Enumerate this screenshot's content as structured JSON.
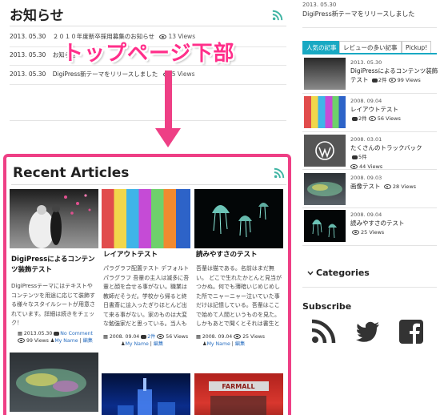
{
  "news": {
    "title": "お知らせ",
    "items": [
      {
        "date": "2013. 05.30",
        "text": "２０１０年度新卒採用募集のお知らせ",
        "views": "13 Views"
      },
      {
        "date": "2013. 05.30",
        "text": "お知らせ",
        "views": ""
      },
      {
        "date": "2013. 05.30",
        "text": "DigiPress新テーマをリリースしました",
        "views": "5 Views"
      }
    ]
  },
  "annotation": {
    "callout": "トップページ下部",
    "arrow_color": "#ee3f85",
    "frame_color": "#ee3f85"
  },
  "recent": {
    "title": "Recent Articles",
    "cards": [
      {
        "title": "DigiPressによるコンテンツ装飾テスト",
        "excerpt": "DigiPressテーマにはテキストやコンテンツを用途に応じて装飾する様々なスタイルシートが用意されています。詳細は続きをチェック！",
        "date": "2013.05.30",
        "comments": "No Comment",
        "views": "99 Views",
        "author": "My Name",
        "edit": "編集"
      },
      {
        "title": "レイアウトテスト",
        "excerpt": "パラグラフ配置テスト デフォルトパラグラフ 吾輩の主人は滅多に吾輩と顔を合せる事がない。職業は教師だそうだ。学校から帰ると終日書斎に這入ったぎりほとんど出て来る事がない。家のものは大変な勉強家だと思っている。当人も勉強家であるかのごとく見せ…",
        "date": "2008. 09.04",
        "comments": "2件",
        "views": "56 Views",
        "author": "My Name",
        "edit": "編集"
      },
      {
        "title": "読みやすさのテスト",
        "excerpt": "吾輩は猫である。名前はまだ無い。 どこで生れたかとんと見当がつかぬ。何でも薄暗いじめじめした所でニャーニャー泣いていた事だけは記憶している。吾輩はここで始めて人間というものを見た。しかもあとで聞くとそれは書生という人間中で一番獰悪な種族であった…",
        "date": "2008. 09.04",
        "comments": "",
        "views": "25 Views",
        "author": "My Name",
        "edit": "編集"
      },
      {
        "title": "",
        "excerpt": ""
      },
      {
        "title": "",
        "excerpt": ""
      },
      {
        "title": "",
        "excerpt": "",
        "thumb_text": "FARMALL"
      }
    ]
  },
  "sidebar": {
    "top_item": {
      "date": "2013. 05.30",
      "text": "DigiPress新テーマをリリースしました"
    },
    "tabs": [
      "人気の記事",
      "レビューの多い記事",
      "Pickup!"
    ],
    "popular": [
      {
        "date": "2013. 05.30",
        "title": "DigiPressによるコンテンツ装飾テスト",
        "comments": "2件",
        "views": "99 Views"
      },
      {
        "date": "2008. 09.04",
        "title": "レイアウトテスト",
        "comments": "2件",
        "views": "56 Views"
      },
      {
        "date": "2008. 03.01",
        "title": "たくさんのトラックバック",
        "comments": "5件",
        "views": "44 Views"
      },
      {
        "date": "2008. 09.03",
        "title": "画像テスト",
        "comments": "",
        "views": "28 Views"
      },
      {
        "date": "2008. 09.04",
        "title": "読みやすさのテスト",
        "comments": "",
        "views": "25 Views"
      }
    ],
    "categories_label": "Categories",
    "subscribe_label": "Subscribe",
    "accent_color": "#19a9c3"
  },
  "icons": {
    "rss": "rss-icon",
    "twitter": "twitter-icon",
    "facebook": "facebook-icon"
  }
}
